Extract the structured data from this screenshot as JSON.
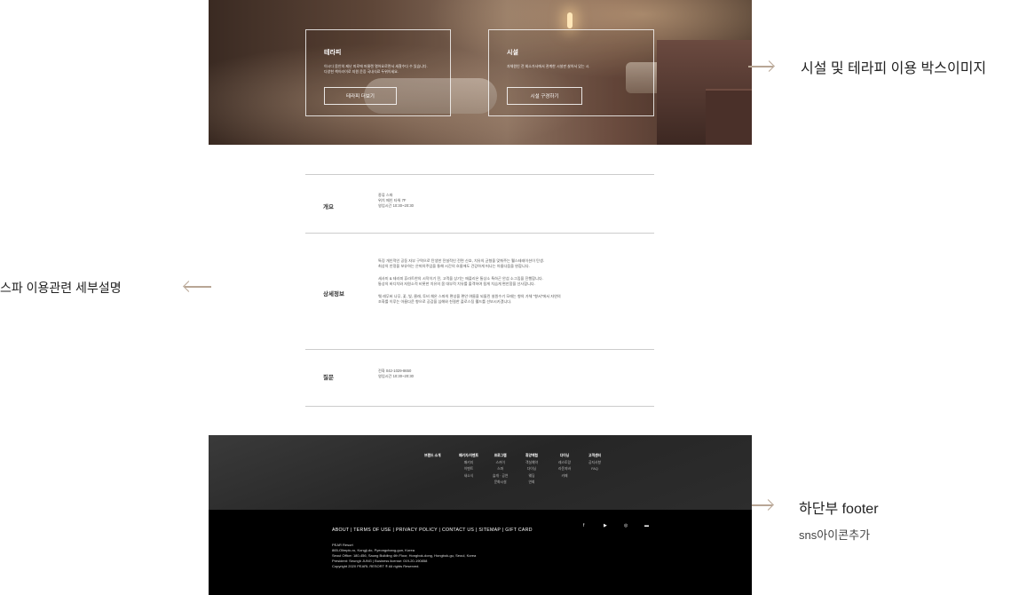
{
  "hero": {
    "therapy": {
      "title": "테라피",
      "desc1": "이시다 몸안의 제난 피로에 머물렌 열어요로면서 세찰수다 수 있습니다.",
      "desc2": "다양한 책이라이로 지원 운증 국내식료 두위이세요.",
      "button": "테라피 더보기"
    },
    "facility": {
      "title": "시설",
      "desc1": "자체원인 전 회소가사에서 관계한 시설판 살아서 있는 시.",
      "button": "시설 구경하기"
    }
  },
  "annotations": {
    "top": "시설 및 테라피 이용 박스이미지",
    "middle": "스파 이용관련 세부설명",
    "footer": "하단부 footer",
    "sns": "sns아이콘추가"
  },
  "info": {
    "overview": {
      "label": "개요",
      "lines": [
        "종류 스파",
        "위치 메인 타워 7F",
        "영업시간 10:30~20:30"
      ]
    },
    "detail": {
      "label": "상세정보",
      "p1": "특징 개인적인 공동 자부 구역으로 탄생한 전설적인 전면 신호, 치유의 균형을 맞춰주는 웰스테레이션이 탄생.",
      "p1b": "최상의 안정을 보유하는 은퇴의주업을 통해 시간의 흐름에도 건강하게 떠나는 아름다움을 완합니다.",
      "p2": "세사미 & 테라피 휴라트한의 시작이기 전, 고객을 상기는 애플리온 통상소 특하곤 안섬 소그립을 진행합니다.",
      "p2b": "통상의 바디치와 자원소적 비롯한 치유의 몸 대부적 치유를 출객하여 됨게 치습게 편안함을 선사합니다.",
      "p3": "웨 레무버 나무, 꽃, 빛, 클래, 투비 채온 스파의 편성을 편안 여름을 되돌린 설원수기 모래는 향의 가체 \"향서\"에서 자연의",
      "p3b": "조화를 이루는 아름다운 향으로 공감을 심해와 친절한 플로스팅 웰드를 선보시키겠니다."
    },
    "inquiry": {
      "label": "질문",
      "lines": [
        "전화 042-1029-8650",
        "영업시간 10:30~20:30"
      ]
    }
  },
  "footer": {
    "nav": [
      {
        "title": "브랜드 소개",
        "items": []
      },
      {
        "title": "패키지/이벤트",
        "items": [
          "패키지",
          "이벤트",
          "새소식"
        ]
      },
      {
        "title": "프로그램",
        "items": [
          "스카이",
          "스파",
          "슬개 · 공연",
          "문화시설"
        ]
      },
      {
        "title": "휴양체험",
        "items": [
          "객실예약",
          "다이닝",
          "웨딩",
          "연회"
        ]
      },
      {
        "title": "다이닝",
        "items": [
          "레스토랑",
          "라운지바",
          "카페"
        ]
      },
      {
        "title": "고객센터",
        "items": [
          "공지사항",
          "FAQ"
        ]
      }
    ],
    "links": "ABOUT | TERMS OF USE | PRIVACY POLICY | CONTACT US | SITEMAP | GIFT CARD",
    "company": [
      "PEAR Resort",
      "865-Olimpic-ro, Kongji-do, Pyeongchang-gun, Korea",
      "Seoul Office: 180-456, Saung Building 4th Floor, Hongbok-dong, Hongbok-gu, Seoul, Korea",
      "President: Seungh JUNG | Business license: 019-20-190858",
      "Copyright 2020 PEARL RESORT ® All rights Reserved."
    ],
    "sns": [
      "f",
      "▶",
      "◎",
      "▬"
    ]
  }
}
